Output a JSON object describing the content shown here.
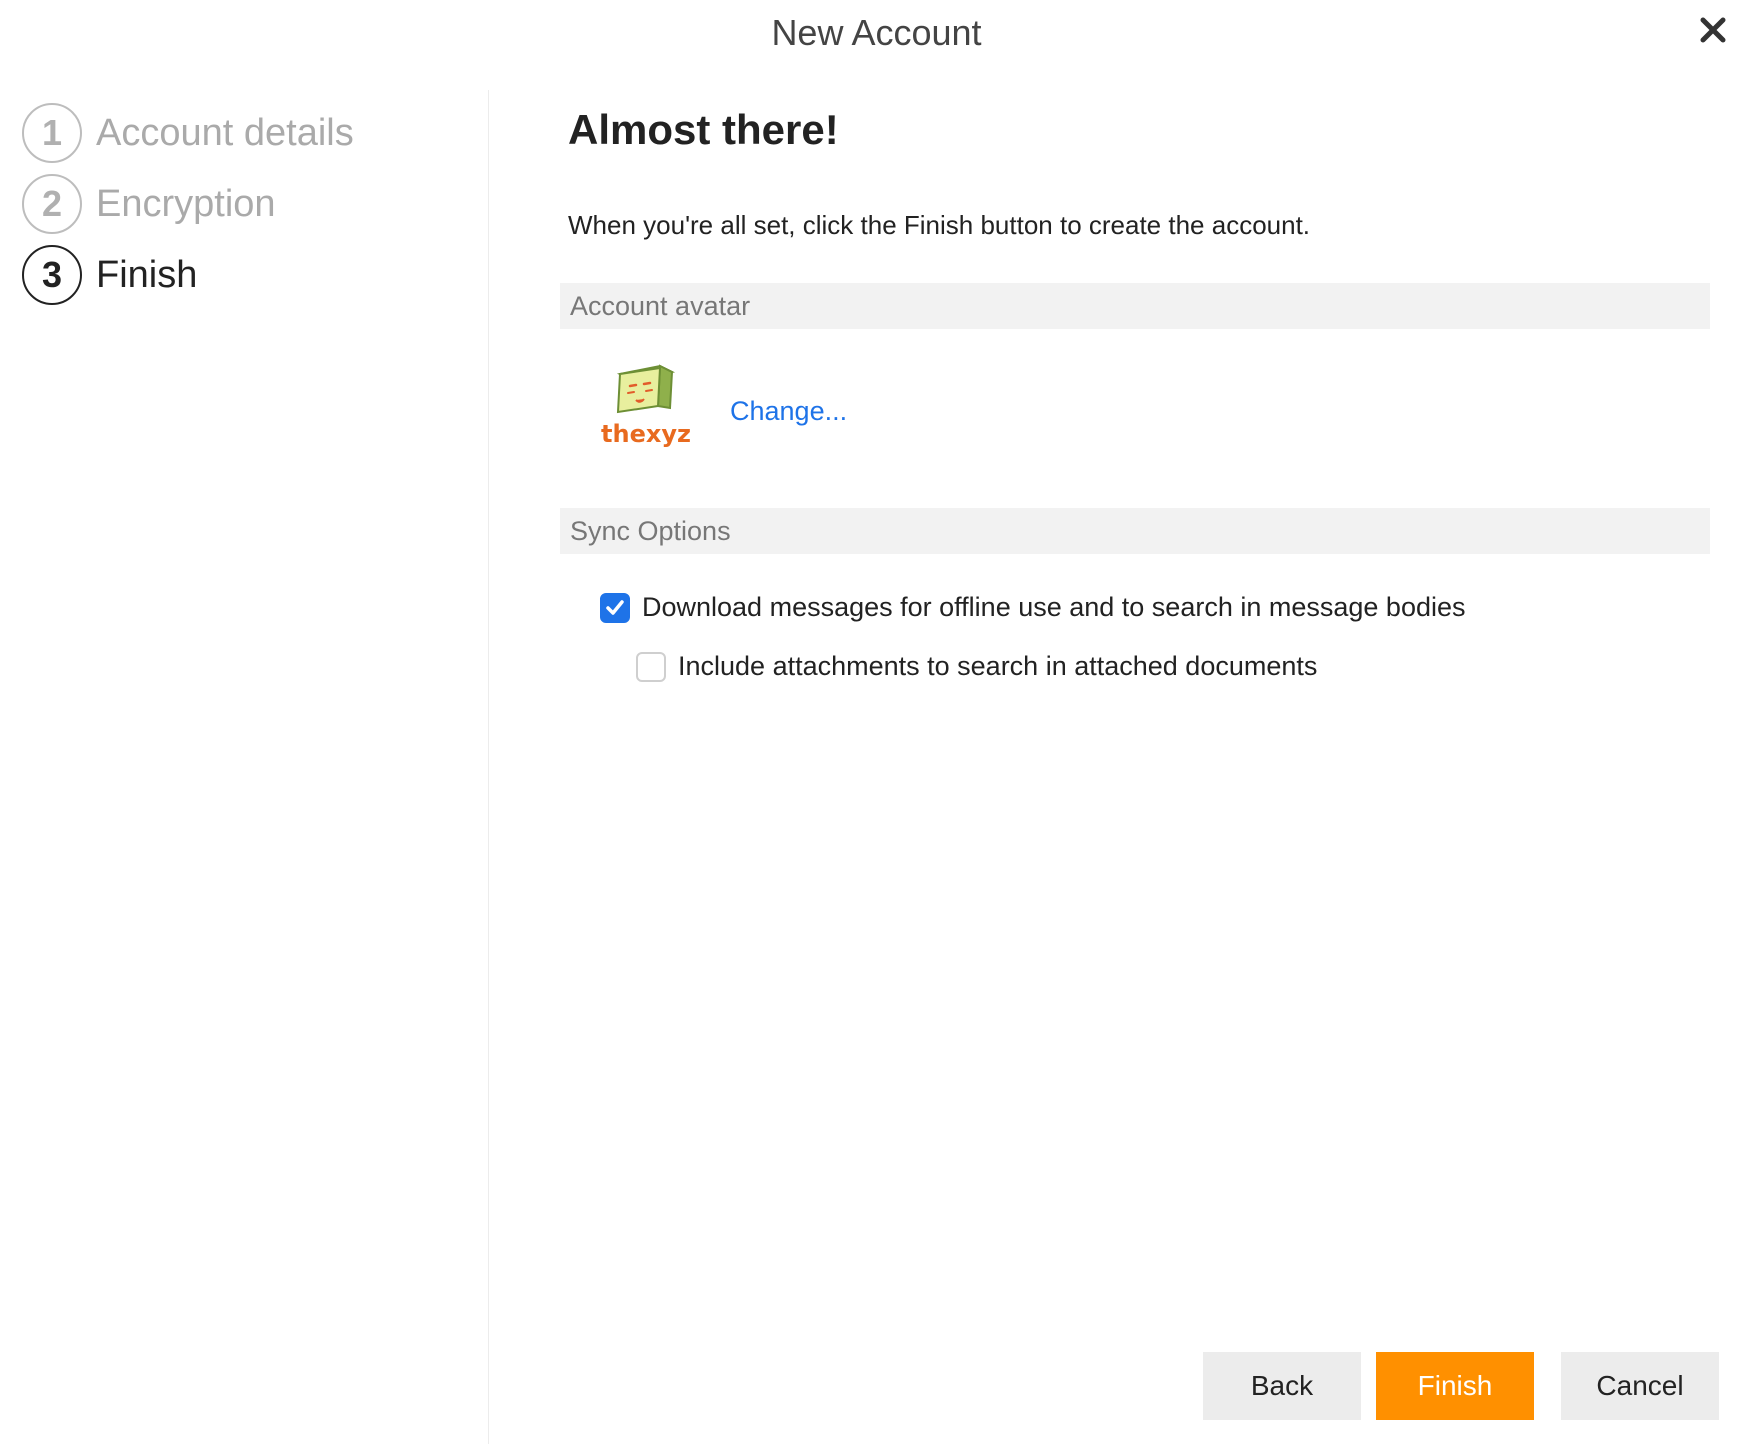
{
  "window": {
    "title": "New Account"
  },
  "steps": [
    {
      "number": "1",
      "label": "Account details"
    },
    {
      "number": "2",
      "label": "Encryption"
    },
    {
      "number": "3",
      "label": "Finish"
    }
  ],
  "main": {
    "heading": "Almost there!",
    "instructions": "When you're all set, click the Finish button to create the account.",
    "avatar_section": {
      "header": "Account avatar",
      "change_label": "Change..."
    },
    "sync_section": {
      "header": "Sync Options",
      "options": [
        {
          "label": "Download messages for offline use and to search in message bodies",
          "checked": true
        },
        {
          "label": "Include attachments to search in attached documents",
          "checked": false
        }
      ]
    }
  },
  "buttons": {
    "back": "Back",
    "finish": "Finish",
    "cancel": "Cancel"
  },
  "colors": {
    "accent": "#1e73e8",
    "primary_button": "#ff9000"
  },
  "avatar_text": "thexyz"
}
